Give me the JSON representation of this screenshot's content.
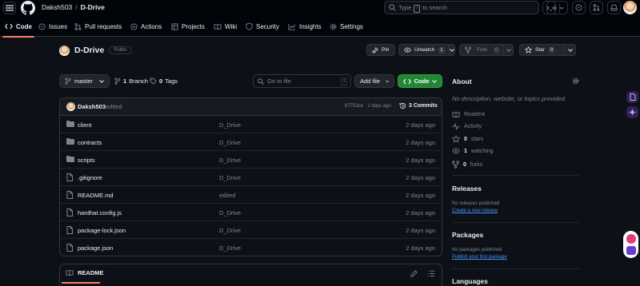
{
  "header": {
    "owner": "Daksh503",
    "separator": "/",
    "repo": "D-Drive",
    "search": {
      "prefix": "Type",
      "key": "/",
      "suffix": "to search"
    }
  },
  "repo_nav": {
    "tabs": [
      {
        "label": "Code",
        "icon": "code-icon"
      },
      {
        "label": "Issues",
        "icon": "issue-icon"
      },
      {
        "label": "Pull requests",
        "icon": "pull-request-icon"
      },
      {
        "label": "Actions",
        "icon": "play-icon"
      },
      {
        "label": "Projects",
        "icon": "table-icon"
      },
      {
        "label": "Wiki",
        "icon": "book-icon"
      },
      {
        "label": "Security",
        "icon": "shield-icon"
      },
      {
        "label": "Insights",
        "icon": "graph-icon"
      },
      {
        "label": "Settings",
        "icon": "gear-icon"
      }
    ]
  },
  "repo_header": {
    "name": "D-Drive",
    "visibility": "Public",
    "pin_label": "Pin",
    "watch_label": "Unwatch",
    "watch_count": "1",
    "fork_label": "Fork",
    "fork_count": "0",
    "star_label": "Star",
    "star_count": "0"
  },
  "toolbar": {
    "branch": "master",
    "branch_count": "1",
    "branch_label": "Branch",
    "tag_count": "0",
    "tag_label": "Tags",
    "go_to_file": "Go to file",
    "go_to_file_key": "t",
    "add_file": "Add file",
    "code": "Code"
  },
  "latest_commit": {
    "author": "Daksh503",
    "message": "edited",
    "hash_date": "67753ce · 2 days ago",
    "commits": "3 Commits"
  },
  "files": [
    {
      "type": "dir",
      "name": "client",
      "message": "D_Drive",
      "date": "2 days ago"
    },
    {
      "type": "dir",
      "name": "contracts",
      "message": "D_Drive",
      "date": "2 days ago"
    },
    {
      "type": "dir",
      "name": "scripts",
      "message": "D_Drive",
      "date": "2 days ago"
    },
    {
      "type": "file",
      "name": ".gitignore",
      "message": "D_Drive",
      "date": "2 days ago"
    },
    {
      "type": "file",
      "name": "README.md",
      "message": "edited",
      "date": "2 days ago"
    },
    {
      "type": "file",
      "name": "hardhat.config.js",
      "message": "D_Drive",
      "date": "2 days ago"
    },
    {
      "type": "file",
      "name": "package-lock.json",
      "message": "D_Drive",
      "date": "2 days ago"
    },
    {
      "type": "file",
      "name": "package.json",
      "message": "D_Drive",
      "date": "2 days ago"
    }
  ],
  "readme": {
    "label": "README"
  },
  "sidebar": {
    "about_title": "About",
    "description": "No description, website, or topics provided.",
    "readme": "Readme",
    "activity": "Activity",
    "stars_count": "0",
    "stars_label": "stars",
    "watching_count": "1",
    "watching_label": "watching",
    "forks_count": "0",
    "forks_label": "forks",
    "releases_title": "Releases",
    "releases_text": "No releases published",
    "releases_link": "Create a new release",
    "packages_title": "Packages",
    "packages_text": "No packages published",
    "packages_link": "Publish your first package",
    "languages_title": "Languages"
  },
  "colors": {
    "background": "#0d1117",
    "header": "#010409",
    "border": "#30363d",
    "text": "#e6edf3",
    "muted": "#7d8590",
    "accent_underline": "#f78166",
    "green_button": "#238636",
    "link": "#4493f8",
    "folder": "#7d8590"
  }
}
